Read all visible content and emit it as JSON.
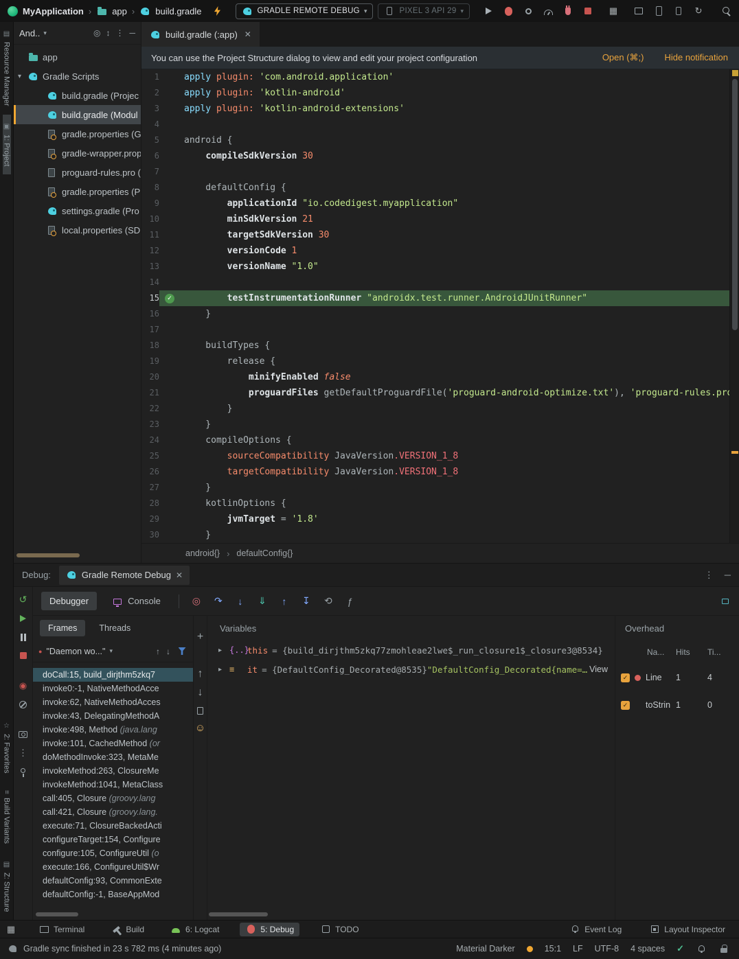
{
  "colors": {
    "accent": "#F0A732",
    "link": "#E8A33D",
    "string_green": "#C3E88D",
    "number_orange": "#F78C6C",
    "keyword_cyan": "#89DDFF",
    "exec_line_bg": "#38573C",
    "selection_bg": "#33525C",
    "panel_bg": "#212121"
  },
  "titlebar": {
    "breadcrumb": [
      "MyApplication",
      "app",
      "build.gradle"
    ],
    "run_config": "GRADLE REMOTE DEBUG",
    "device": "PIXEL 3 API 29"
  },
  "left_rail": {
    "top": [
      "Resource Manager",
      "1: Project"
    ],
    "bottom": [
      "2: Favorites",
      "Build Variants",
      "Z: Structure"
    ]
  },
  "project": {
    "selector": "And..",
    "tree": [
      {
        "label": "app",
        "icon": "folder",
        "depth": 0
      },
      {
        "label": "Gradle Scripts",
        "icon": "gradle",
        "depth": 0,
        "expanded": true
      },
      {
        "label": "build.gradle (Projec",
        "icon": "gradle",
        "depth": 1
      },
      {
        "label": "build.gradle (Modul",
        "icon": "gradle",
        "depth": 1,
        "selected": true
      },
      {
        "label": "gradle.properties (G",
        "icon": "props",
        "depth": 1
      },
      {
        "label": "gradle-wrapper.prop",
        "icon": "props",
        "depth": 1
      },
      {
        "label": "proguard-rules.pro (",
        "icon": "file",
        "depth": 1
      },
      {
        "label": "gradle.properties (P",
        "icon": "props",
        "depth": 1
      },
      {
        "label": "settings.gradle (Pro",
        "icon": "gradle",
        "depth": 1
      },
      {
        "label": "local.properties (SD",
        "icon": "props",
        "depth": 1
      }
    ]
  },
  "editor": {
    "tab": "build.gradle (:app)",
    "notification": {
      "text": "You can use the Project Structure dialog to view and edit your project configuration",
      "open_label": "Open (⌘;)",
      "hide_label": "Hide notification"
    },
    "breadcrumbs": [
      "android{}",
      "defaultConfig{}"
    ],
    "lines": [
      {
        "n": "1",
        "t": [
          [
            "kw",
            "apply"
          ],
          [
            "pl",
            " "
          ],
          [
            "attr",
            "plugin:"
          ],
          [
            "pl",
            " "
          ],
          [
            "str",
            "'com.android.application'"
          ]
        ]
      },
      {
        "n": "2",
        "t": [
          [
            "kw",
            "apply"
          ],
          [
            "pl",
            " "
          ],
          [
            "attr",
            "plugin:"
          ],
          [
            "pl",
            " "
          ],
          [
            "str",
            "'kotlin-android'"
          ]
        ]
      },
      {
        "n": "3",
        "t": [
          [
            "kw",
            "apply"
          ],
          [
            "pl",
            " "
          ],
          [
            "attr",
            "plugin:"
          ],
          [
            "pl",
            " "
          ],
          [
            "str",
            "'kotlin-android-extensions'"
          ]
        ]
      },
      {
        "n": "4",
        "t": []
      },
      {
        "n": "5",
        "t": [
          [
            "pl",
            "android {"
          ]
        ]
      },
      {
        "n": "6",
        "t": [
          [
            "pl",
            "    "
          ],
          [
            "prop",
            "compileSdkVersion"
          ],
          [
            "pl",
            " "
          ],
          [
            "num",
            "30"
          ]
        ]
      },
      {
        "n": "7",
        "t": []
      },
      {
        "n": "8",
        "t": [
          [
            "pl",
            "    defaultConfig {"
          ]
        ]
      },
      {
        "n": "9",
        "t": [
          [
            "pl",
            "        "
          ],
          [
            "prop",
            "applicationId"
          ],
          [
            "pl",
            " "
          ],
          [
            "str",
            "\"io.codedigest.myapplication\""
          ]
        ]
      },
      {
        "n": "10",
        "t": [
          [
            "pl",
            "        "
          ],
          [
            "prop",
            "minSdkVersion"
          ],
          [
            "pl",
            " "
          ],
          [
            "num",
            "21"
          ]
        ]
      },
      {
        "n": "11",
        "t": [
          [
            "pl",
            "        "
          ],
          [
            "prop",
            "targetSdkVersion"
          ],
          [
            "pl",
            " "
          ],
          [
            "num",
            "30"
          ]
        ]
      },
      {
        "n": "12",
        "t": [
          [
            "pl",
            "        "
          ],
          [
            "prop",
            "versionCode"
          ],
          [
            "pl",
            " "
          ],
          [
            "num",
            "1"
          ]
        ]
      },
      {
        "n": "13",
        "t": [
          [
            "pl",
            "        "
          ],
          [
            "prop",
            "versionName"
          ],
          [
            "pl",
            " "
          ],
          [
            "str",
            "\"1.0\""
          ]
        ]
      },
      {
        "n": "14",
        "t": []
      },
      {
        "n": "15",
        "exec": true,
        "t": [
          [
            "pl",
            "        "
          ],
          [
            "prop",
            "testInstrumentationRunner"
          ],
          [
            "pl",
            " "
          ],
          [
            "str",
            "\"androidx.test.runner.AndroidJUnitRunner\""
          ]
        ]
      },
      {
        "n": "16",
        "t": [
          [
            "pl",
            "    }"
          ]
        ]
      },
      {
        "n": "17",
        "t": []
      },
      {
        "n": "18",
        "t": [
          [
            "pl",
            "    buildTypes {"
          ]
        ]
      },
      {
        "n": "19",
        "t": [
          [
            "pl",
            "        release {"
          ]
        ]
      },
      {
        "n": "20",
        "t": [
          [
            "pl",
            "            "
          ],
          [
            "prop",
            "minifyEnabled"
          ],
          [
            "pl",
            " "
          ],
          [
            "const",
            "false"
          ]
        ]
      },
      {
        "n": "21",
        "t": [
          [
            "pl",
            "            "
          ],
          [
            "prop",
            "proguardFiles"
          ],
          [
            "pl",
            " getDefaultProguardFile("
          ],
          [
            "str",
            "'proguard-android-optimize.txt'"
          ],
          [
            "pl",
            "), "
          ],
          [
            "str",
            "'proguard-rules.pro'"
          ]
        ]
      },
      {
        "n": "22",
        "t": [
          [
            "pl",
            "        }"
          ]
        ]
      },
      {
        "n": "23",
        "t": [
          [
            "pl",
            "    }"
          ]
        ]
      },
      {
        "n": "24",
        "t": [
          [
            "pl",
            "    compileOptions {"
          ]
        ]
      },
      {
        "n": "25",
        "t": [
          [
            "pl",
            "        "
          ],
          [
            "attr",
            "sourceCompatibility"
          ],
          [
            "pl",
            " JavaVersion"
          ],
          [
            "field",
            ".VERSION_1_8"
          ]
        ]
      },
      {
        "n": "26",
        "t": [
          [
            "pl",
            "        "
          ],
          [
            "attr",
            "targetCompatibility"
          ],
          [
            "pl",
            " JavaVersion"
          ],
          [
            "field",
            ".VERSION_1_8"
          ]
        ]
      },
      {
        "n": "27",
        "t": [
          [
            "pl",
            "    }"
          ]
        ]
      },
      {
        "n": "28",
        "t": [
          [
            "pl",
            "    kotlinOptions {"
          ]
        ]
      },
      {
        "n": "29",
        "t": [
          [
            "pl",
            "        "
          ],
          [
            "prop",
            "jvmTarget"
          ],
          [
            "pl",
            " = "
          ],
          [
            "str",
            "'1.8'"
          ]
        ]
      },
      {
        "n": "30",
        "t": [
          [
            "pl",
            "    }"
          ]
        ]
      }
    ]
  },
  "debug": {
    "label": "Debug:",
    "session_tab": "Gradle Remote Debug",
    "tabs": [
      "Debugger",
      "Console"
    ],
    "view_tabs": [
      "Frames",
      "Threads"
    ],
    "thread_selector": "\"Daemon wo...\"",
    "frames": [
      {
        "text": "doCall:15, build_dirjthm5zkq7",
        "selected": true
      },
      {
        "text": "invoke0:-1, NativeMethodAcce"
      },
      {
        "text": "invoke:62, NativeMethodAcces"
      },
      {
        "text": "invoke:43, DelegatingMethodA"
      },
      {
        "text": "invoke:498, Method ",
        "italic": "(java.lang"
      },
      {
        "text": "invoke:101, CachedMethod ",
        "italic": "(or"
      },
      {
        "text": "doMethodInvoke:323, MetaMe"
      },
      {
        "text": "invokeMethod:263, ClosureMe"
      },
      {
        "text": "invokeMethod:1041, MetaClass"
      },
      {
        "text": "call:405, Closure ",
        "italic": "(groovy.lang"
      },
      {
        "text": "call:421, Closure ",
        "italic": "(groovy.lang."
      },
      {
        "text": "execute:71, ClosureBackedActi"
      },
      {
        "text": "configureTarget:154, Configure"
      },
      {
        "text": "configure:105, ConfigureUtil ",
        "italic": "(o"
      },
      {
        "text": "execute:166, ConfigureUtil$Wr"
      },
      {
        "text": "defaultConfig:93, CommonExte"
      },
      {
        "text": "defaultConfig:-1, BaseAppMod"
      }
    ],
    "variables": {
      "title": "Variables",
      "rows": [
        {
          "icon": "closure",
          "name": "this",
          "value": "= {build_dirjthm5zkq77zmohleae2lwe$_run_closure1$_closure3@8534}"
        },
        {
          "icon": "object",
          "name": "it",
          "value": "= {DefaultConfig_Decorated@8535} ",
          "string": "\"DefaultConfig_Decorated{name=mai...",
          "link": "View"
        }
      ]
    },
    "overhead": {
      "title": "Overhead",
      "columns": [
        "Na...",
        "Hits",
        "Ti..."
      ],
      "rows": [
        {
          "checked": true,
          "dot": true,
          "name": "Line",
          "hits": "1",
          "time": "4"
        },
        {
          "checked": true,
          "dot": false,
          "name": "toStrin",
          "hits": "1",
          "time": "0"
        }
      ]
    }
  },
  "bottom_bar": {
    "left": [
      {
        "label": "Terminal",
        "icon": "terminal"
      },
      {
        "label": "Build",
        "icon": "build"
      },
      {
        "label": "6: Logcat",
        "icon": "logcat"
      },
      {
        "label": "5: Debug",
        "icon": "debug",
        "active": true
      },
      {
        "label": "TODO",
        "icon": "todo"
      }
    ],
    "right": [
      {
        "label": "Event Log",
        "icon": "event-log"
      },
      {
        "label": "Layout Inspector",
        "icon": "layout-inspector"
      }
    ]
  },
  "status_bar": {
    "message": "Gradle sync finished in 23 s 782 ms (4 minutes ago)",
    "theme": "Material Darker",
    "caret": "15:1",
    "line_separator": "LF",
    "encoding": "UTF-8",
    "indent": "4 spaces"
  }
}
